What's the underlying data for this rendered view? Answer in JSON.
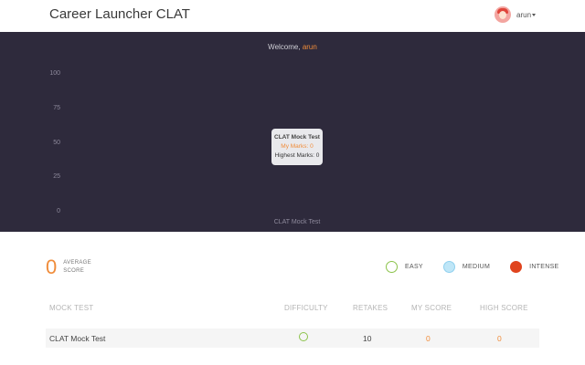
{
  "header": {
    "title": "Career Launcher CLAT",
    "user_name": "arun"
  },
  "welcome": {
    "prefix": "Welcome, ",
    "name": "arun"
  },
  "chart_data": {
    "type": "bar",
    "categories": [
      "CLAT Mock Test"
    ],
    "series": [
      {
        "name": "My Marks",
        "values": [
          0
        ]
      },
      {
        "name": "Highest Marks",
        "values": [
          0
        ]
      }
    ],
    "ylim": [
      0,
      100
    ],
    "yticks": [
      100,
      75,
      50,
      25,
      0
    ],
    "tooltip": {
      "title": "CLAT Mock Test",
      "my_marks": "My Marks: 0",
      "highest_marks": "Highest Marks: 0"
    },
    "grid": false
  },
  "summary": {
    "average_score": "0",
    "average_label_line1": "AVERAGE",
    "average_label_line2": "SCORE"
  },
  "legend": [
    {
      "label": "EASY",
      "fill": "#ffffff",
      "border": "#8bc34a",
      "icon": "circle-outline-icon"
    },
    {
      "label": "MEDIUM",
      "fill": "#bfe6f7",
      "border": "#8fd0ee",
      "icon": "circle-icon"
    },
    {
      "label": "INTENSE",
      "fill": "#e0441e",
      "border": "#e0441e",
      "icon": "circle-icon"
    }
  ],
  "table": {
    "headers": [
      "MOCK TEST",
      "DIFFICULTY",
      "RETAKES",
      "MY SCORE",
      "HIGH SCORE"
    ],
    "rows": [
      {
        "name": "CLAT Mock Test",
        "difficulty": "easy",
        "retakes": "10",
        "my_score": "0",
        "high_score": "0"
      }
    ]
  },
  "colors": {
    "panel_bg": "#2e2a3c",
    "accent": "#f08c3a"
  }
}
